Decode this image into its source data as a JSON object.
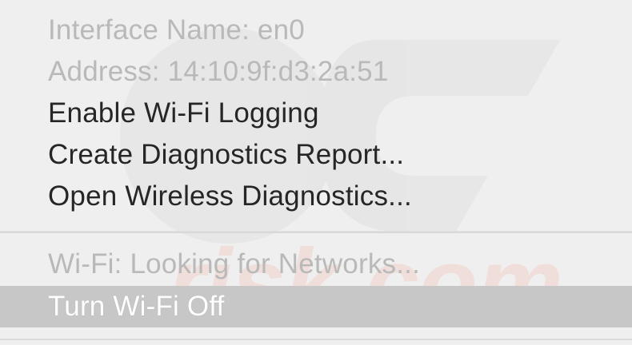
{
  "menu": {
    "interface_name": "Interface Name: en0",
    "address": "Address: 14:10:9f:d3:2a:51",
    "enable_logging": "Enable Wi-Fi Logging",
    "create_report": "Create Diagnostics Report...",
    "open_diagnostics": "Open Wireless Diagnostics...",
    "wifi_status": "Wi-Fi: Looking for Networks...",
    "turn_off": "Turn Wi-Fi Off"
  },
  "watermark": {
    "logo_text": "PC",
    "site_text": "risk.com"
  },
  "colors": {
    "background": "#f0efef",
    "text": "#262626",
    "disabled_text": "#b9b9b9",
    "highlight": "#c7c7c7",
    "watermark_red": "#e86a4a"
  }
}
